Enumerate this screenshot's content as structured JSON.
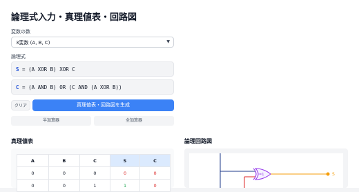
{
  "app": {
    "title": "論理式入力・真理値表・回路図"
  },
  "inputs": {
    "var_count_label": "変数の数",
    "var_count_value": "3変数 (A, B, C)",
    "formula_label": "論理式",
    "formulas": [
      {
        "var": "S",
        "eq": " = ",
        "expr": "(A XOR B) XOR C"
      },
      {
        "var": "C",
        "eq": " = ",
        "expr": "(A AND B) OR (C AND (A XOR B))"
      }
    ]
  },
  "buttons": {
    "clear": "クリア",
    "generate": "真理値表・回路図を生成",
    "preset_half": "半加算器",
    "preset_full": "全加算器"
  },
  "truth_table": {
    "title": "真理値表",
    "headers": [
      "A",
      "B",
      "C",
      "S",
      "C"
    ],
    "rows": [
      [
        "0",
        "0",
        "0",
        "0",
        "0"
      ],
      [
        "0",
        "0",
        "1",
        "1",
        "0"
      ]
    ]
  },
  "circuit": {
    "title": "論理回路図",
    "gate_label": "=1",
    "output_label": "S",
    "colors": {
      "wire_a": "#1e3a8a",
      "wire_b": "#dc2626",
      "gate": "#9333ea",
      "output": "#f59e0b"
    }
  }
}
